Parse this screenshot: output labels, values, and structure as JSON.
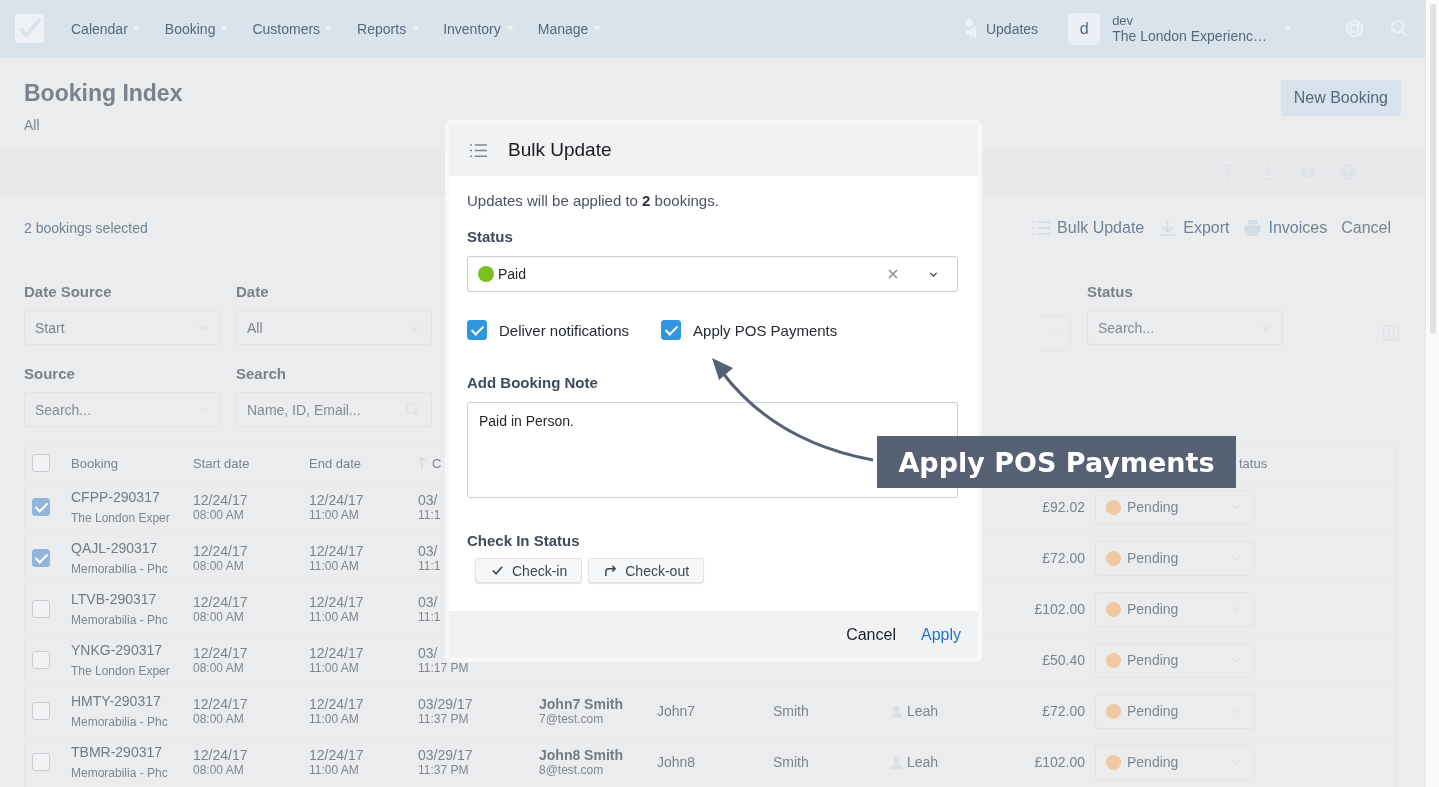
{
  "nav": {
    "items": [
      {
        "label": "Calendar"
      },
      {
        "label": "Booking"
      },
      {
        "label": "Customers"
      },
      {
        "label": "Reports"
      },
      {
        "label": "Inventory"
      },
      {
        "label": "Manage"
      }
    ],
    "updates": "Updates",
    "avatar": "d",
    "user": "dev",
    "company": "The London Experienc…"
  },
  "page": {
    "title": "Booking Index",
    "subtitle": "All",
    "new_button": "New Booking",
    "selection": "2 bookings selected",
    "actions": [
      {
        "kind": "list",
        "label": "Bulk Update"
      },
      {
        "kind": "download",
        "label": "Export"
      },
      {
        "kind": "print",
        "label": "Invoices"
      },
      {
        "kind": "plain",
        "label": "Cancel"
      }
    ]
  },
  "filters": [
    {
      "kind": "select",
      "label": "Date Source",
      "value": "Start"
    },
    {
      "kind": "select",
      "label": "Date",
      "value": "All"
    },
    {
      "kind": "select",
      "label": "Source",
      "placeholder": "Search..."
    },
    {
      "kind": "search",
      "label": "Search",
      "placeholder": "Name, ID, Email..."
    }
  ],
  "status_filter": {
    "label": "Status",
    "placeholder": "Search..."
  },
  "table": {
    "columns": [
      "Booking",
      "Start date",
      "End date",
      "C"
    ],
    "status_column": "tatus",
    "header_checked": false,
    "rows": [
      {
        "selected": true,
        "booking": "CFPP-290317",
        "product": "The London Exper",
        "start_date": "12/24/17",
        "start_time": "08:00 AM",
        "end_date": "12/24/17",
        "end_time": "11:00 AM",
        "created_date": "03/",
        "created_time": "11:1",
        "total": "£92.02",
        "status": "Pending",
        "color": "#f0c8a2"
      },
      {
        "selected": true,
        "booking": "QAJL-290317",
        "product": "Memorabilia - Phc",
        "start_date": "12/24/17",
        "start_time": "08:00 AM",
        "end_date": "12/24/17",
        "end_time": "11:00 AM",
        "created_date": "03/",
        "created_time": "11:1",
        "total": "£72.00",
        "status": "Pending",
        "color": "#f0c8a2"
      },
      {
        "selected": false,
        "booking": "LTVB-290317",
        "product": "Memorabilia - Phc",
        "start_date": "12/24/17",
        "start_time": "08:00 AM",
        "end_date": "12/24/17",
        "end_time": "11:00 AM",
        "created_date": "03/",
        "created_time": "11:1",
        "total": "£102.00",
        "status": "Pending",
        "color": "#f0c8a2"
      },
      {
        "selected": false,
        "booking": "YNKG-290317",
        "product": "The London Exper",
        "start_date": "12/24/17",
        "start_time": "08:00 AM",
        "end_date": "12/24/17",
        "end_time": "11:00 AM",
        "created_date": "03/",
        "created_time": "11:17 PM",
        "total": "£50.40",
        "status": "Pending",
        "color": "#f0c8a2"
      },
      {
        "selected": false,
        "booking": "HMTY-290317",
        "product": "Memorabilia - Phc",
        "start_date": "12/24/17",
        "start_time": "08:00 AM",
        "end_date": "12/24/17",
        "end_time": "11:00 AM",
        "created_date": "03/29/17",
        "created_time": "11:37 PM",
        "customer": "John7 Smith",
        "email": "7@test.com",
        "first": "John7",
        "last": "Smith",
        "staff": "Leah",
        "total": "£72.00",
        "status": "Pending",
        "color": "#f0c8a2"
      },
      {
        "selected": false,
        "booking": "TBMR-290317",
        "product": "Memorabilia - Phc",
        "start_date": "12/24/17",
        "start_time": "08:00 AM",
        "end_date": "12/24/17",
        "end_time": "11:00 AM",
        "created_date": "03/29/17",
        "created_time": "11:37 PM",
        "customer": "John8 Smith",
        "email": "8@test.com",
        "first": "John8",
        "last": "Smith",
        "staff": "Leah",
        "total": "£102.00",
        "status": "Pending",
        "color": "#f0c8a2"
      }
    ]
  },
  "modal": {
    "title": "Bulk Update",
    "intro": "Updates will be applied to **2** bookings.",
    "status_label": "Status",
    "status": {
      "label": "Paid",
      "color": "#7ac020"
    },
    "options": [
      {
        "label": "Deliver notifications",
        "checked": true
      },
      {
        "label": "Apply POS Payments",
        "checked": true
      }
    ],
    "note_label": "Add Booking Note",
    "note": "Paid in Person.",
    "checkin_label": "Check In Status",
    "checkin_buttons": [
      {
        "kind": "check",
        "label": "Check-in"
      },
      {
        "kind": "out",
        "label": "Check-out"
      }
    ],
    "cancel": "Cancel",
    "apply": "Apply"
  },
  "callout": "Apply POS Payments"
}
